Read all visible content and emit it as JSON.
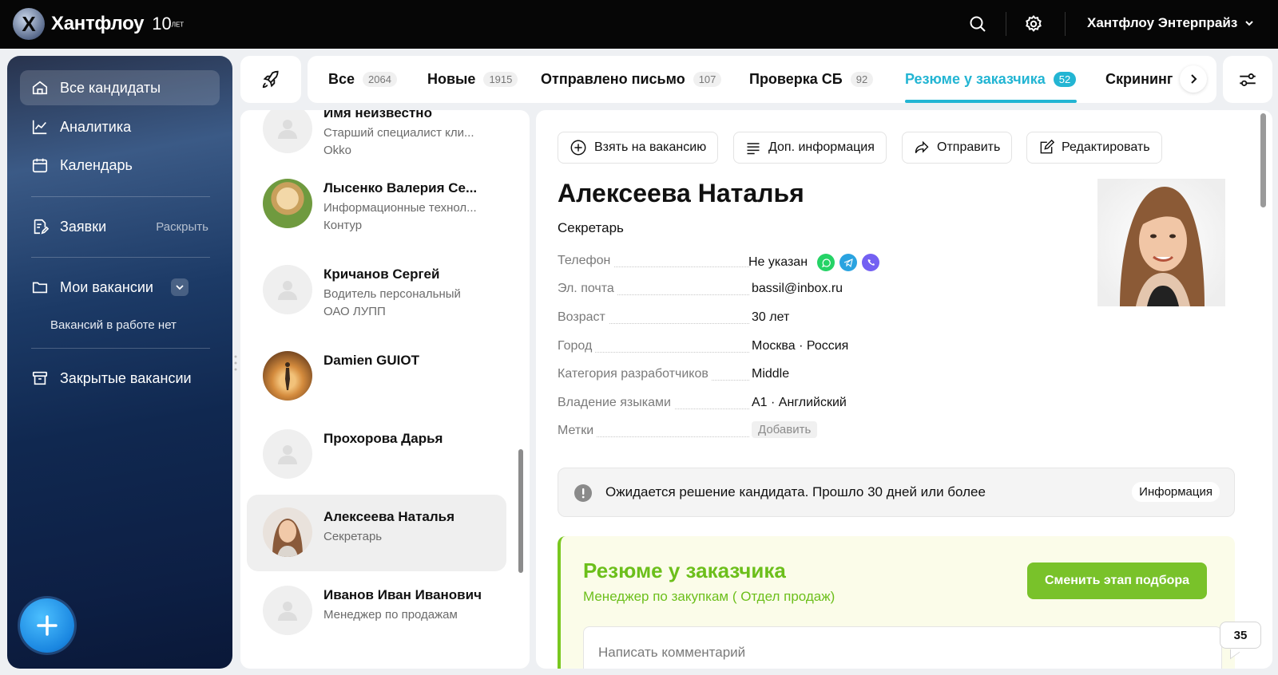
{
  "topbar": {
    "logo_letter": "X",
    "logo_text": "Хантфлоу",
    "anniversary": "10",
    "anniversary_small": "ЛЕТ",
    "company": "Хантфлоу Энтерпрайз"
  },
  "sidebar": {
    "items": [
      {
        "label": "Все кандидаты"
      },
      {
        "label": "Аналитика"
      },
      {
        "label": "Календарь"
      },
      {
        "label": "Заявки",
        "extra": "Раскрыть"
      },
      {
        "label": "Мои вакансии"
      },
      {
        "label": "Закрытые вакансии"
      }
    ],
    "no_vacancies_note": "Вакансий в работе нет"
  },
  "tabs": [
    {
      "label": "Все",
      "count": "2064"
    },
    {
      "label": "Новые",
      "count": "1915"
    },
    {
      "label": "Отправлено письмо",
      "count": "107"
    },
    {
      "label": "Проверка СБ",
      "count": "92"
    },
    {
      "label": "Резюме у заказчика",
      "count": "52"
    },
    {
      "label": "Скрининг"
    }
  ],
  "candidates": [
    {
      "name": "Имя неизвестно",
      "line2": "Старший специалист кли...",
      "line3": "Okko"
    },
    {
      "name": "Лысенко Валерия Се...",
      "line2": "Информационные технол...",
      "line3": "Контур"
    },
    {
      "name": "Кричанов Сергей",
      "line2": "Водитель персональный",
      "line3": "ОАО ЛУПП"
    },
    {
      "name": "Damien GUIOT",
      "line2": "",
      "line3": ""
    },
    {
      "name": "Прохорова Дарья",
      "line2": "",
      "line3": ""
    },
    {
      "name": "Алексеева Наталья",
      "line2": "Секретарь",
      "line3": ""
    },
    {
      "name": "Иванов Иван Иванович",
      "line2": "Менеджер по продажам",
      "line3": ""
    }
  ],
  "detail": {
    "actions": {
      "take": "Взять на вакансию",
      "info": "Доп. информация",
      "send": "Отправить",
      "edit": "Редактировать"
    },
    "name": "Алексеева Наталья",
    "position": "Секретарь",
    "fields": [
      {
        "label": "Телефон",
        "value": "Не указан"
      },
      {
        "label": "Эл. почта",
        "value": "bassil@inbox.ru"
      },
      {
        "label": "Возраст",
        "value": "30 лет"
      },
      {
        "label": "Город",
        "value": "Москва · Россия"
      },
      {
        "label": "Категория разработчиков",
        "value": "Middle"
      },
      {
        "label": "Владение языками",
        "value": "A1 · Английский"
      },
      {
        "label": "Метки",
        "value": "Добавить"
      }
    ],
    "alert": {
      "text": "Ожидается решение кандидата. Прошло 30 дней или более",
      "button": "Информация"
    },
    "stage": {
      "title": "Резюме у заказчика",
      "vacancy": "Менеджер по закупкам ( Отдел продаж)",
      "change_button": "Сменить этап подбора",
      "comment_placeholder": "Написать комментарий"
    }
  },
  "chat_counter": "35",
  "colors": {
    "accent": "#23b5d3",
    "stage_green": "#79c22a",
    "topbar": "#060606"
  }
}
